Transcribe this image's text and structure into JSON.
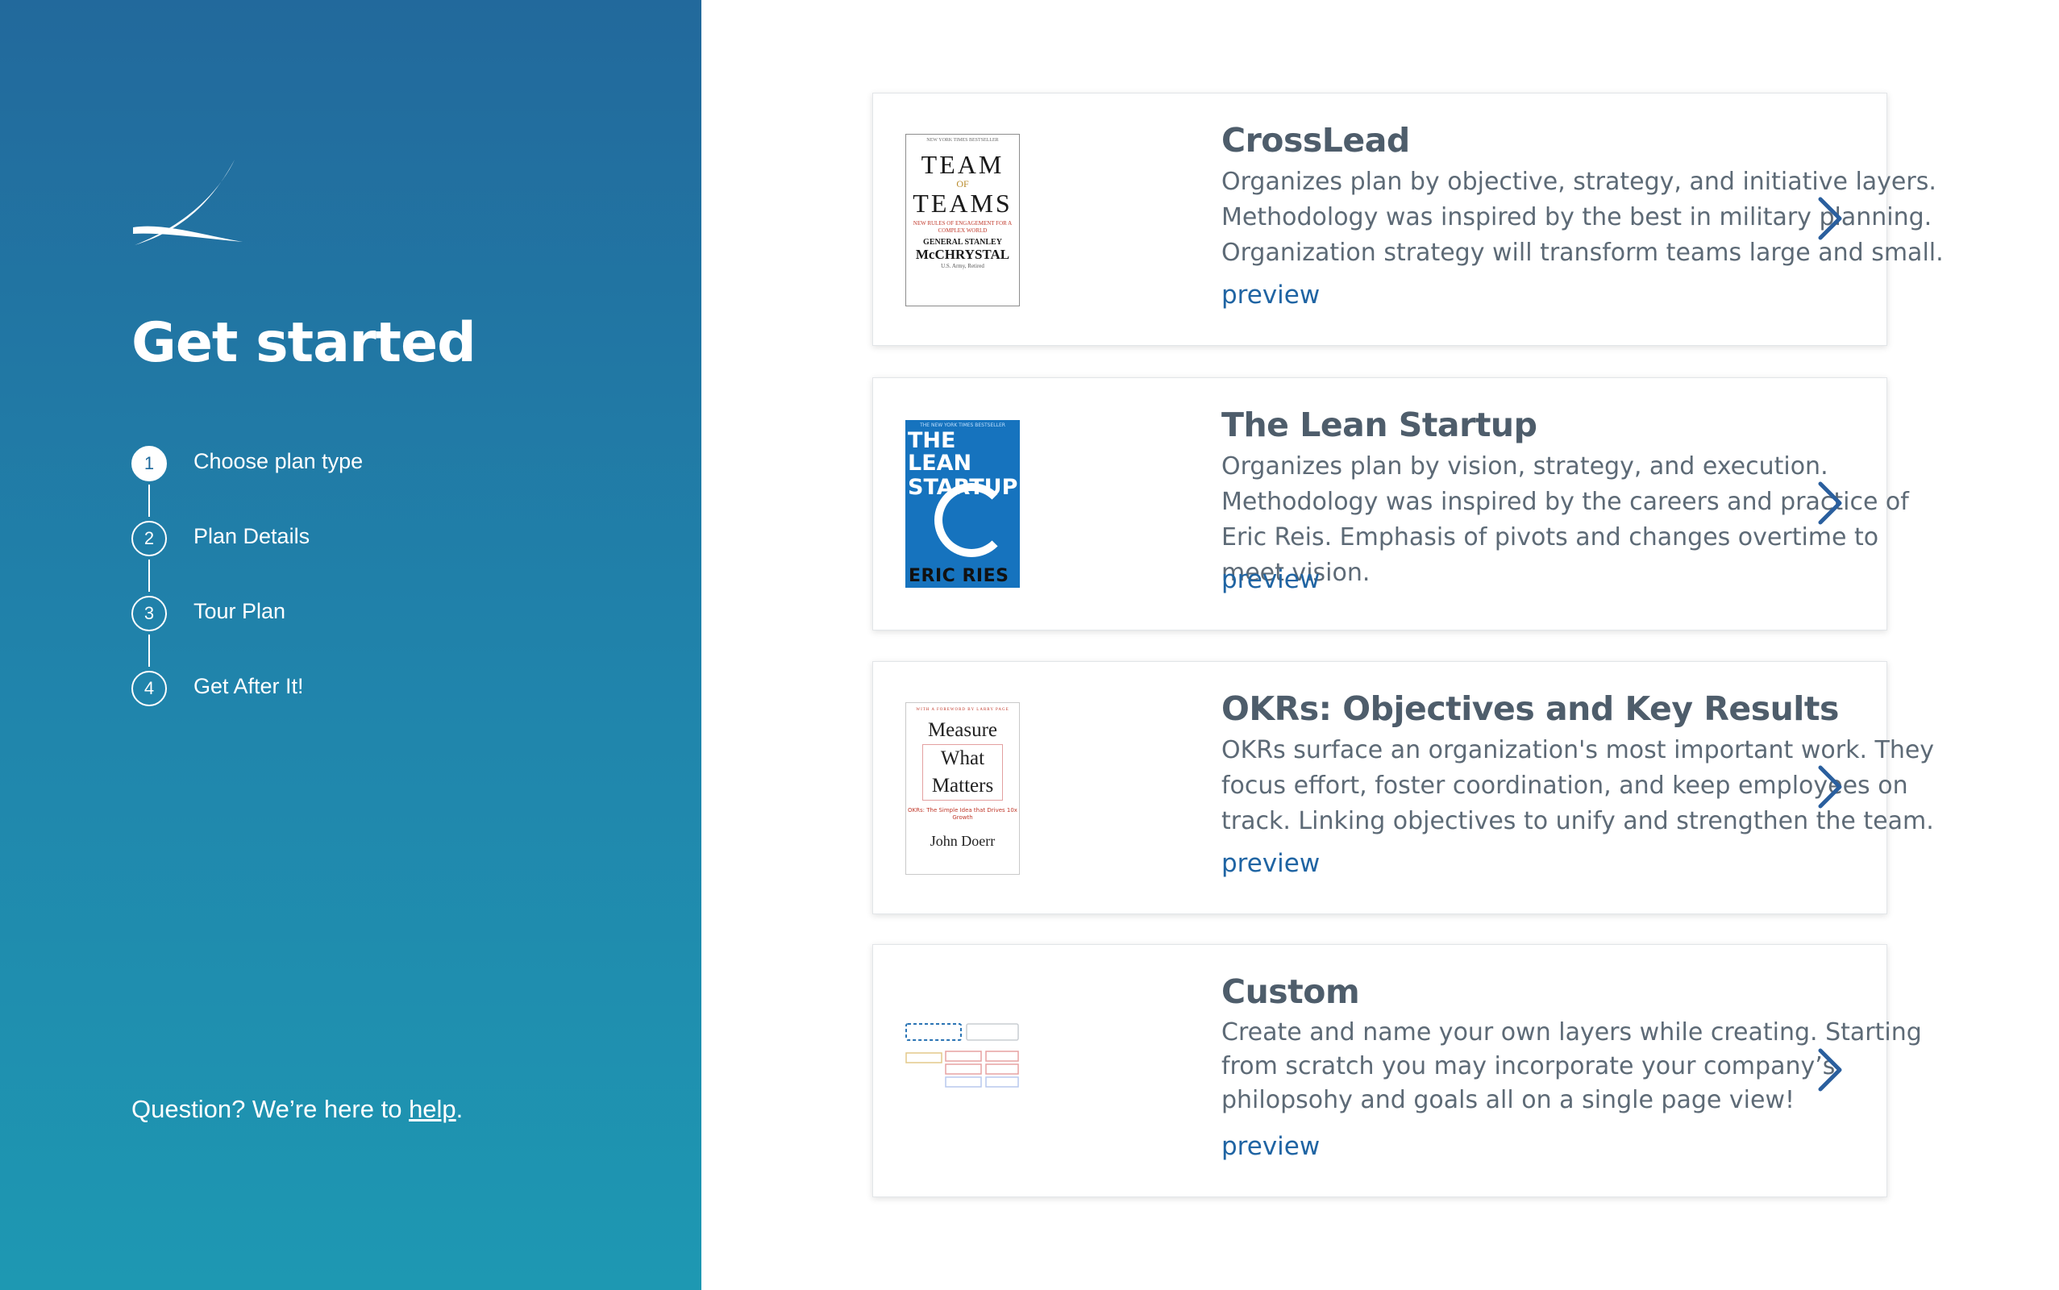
{
  "sidebar": {
    "title": "Get started",
    "steps": [
      {
        "number": "1",
        "label": "Choose plan type"
      },
      {
        "number": "2",
        "label": "Plan Details"
      },
      {
        "number": "3",
        "label": "Tour Plan"
      },
      {
        "number": "4",
        "label": "Get After It!"
      }
    ],
    "help_prefix": "Question? We’re here to ",
    "help_link": "help",
    "help_suffix": "."
  },
  "plans": [
    {
      "title": "CrossLead",
      "description": "Organizes plan by objective, strategy, and initiative layers. Methodology was inspired by the best in military planning. Organization strategy will transform teams large and small.",
      "preview": "preview",
      "cover": {
        "top": "NEW YORK TIMES BESTSELLER",
        "line1": "TEAM",
        "line2": "OF",
        "line3": "TEAMS",
        "tagline": "NEW RULES OF ENGAGEMENT FOR A COMPLEX WORLD",
        "author_title": "GENERAL STANLEY",
        "author_name": "McCHRYSTAL",
        "author_rank": "U.S. Army, Retired"
      }
    },
    {
      "title": "The Lean Startup",
      "description": "Organizes plan by vision, strategy, and execution. Methodology was inspired by the careers and practice of Eric Reis. Emphasis of pivots and changes overtime to meet vision.",
      "preview": "preview",
      "cover": {
        "top": "THE NEW YORK TIMES BESTSELLER",
        "line1": "THE LEAN",
        "line2": "STARTUP",
        "author": "ERIC RIES"
      }
    },
    {
      "title": "OKRs: Objectives and Key Results",
      "description": "OKRs surface an organization's most important work. They focus effort, foster coordination, and keep employees on track. Linking objectives to unify and strengthen the team.",
      "preview": "preview",
      "cover": {
        "top": "WITH A FOREWORD BY LARRY PAGE",
        "line1": "Measure",
        "line2": "What",
        "line3": "Matters",
        "subtitle": "OKRs: The Simple Idea that Drives 10x Growth",
        "author": "John Doerr"
      }
    },
    {
      "title": "Custom",
      "description": "Create and name your own layers while creating. Starting from scratch you may incorporate your company’s philopsohy and goals all on a single page view!",
      "preview": "preview"
    }
  ],
  "colors": {
    "sidebar_top": "#22699c",
    "sidebar_bottom": "#1e98b2",
    "title_text": "#4e5d6b",
    "body_text": "#5d6a76",
    "link": "#1f64a3",
    "chevron": "#2a5f9e"
  },
  "icons": {
    "logo": "swoosh-logo-icon",
    "chevron": "chevron-right-icon"
  }
}
